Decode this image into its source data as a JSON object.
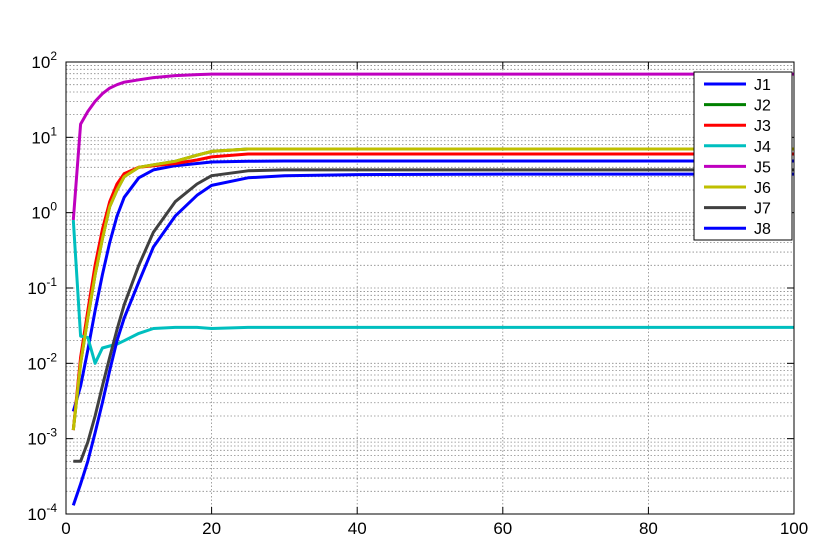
{
  "chart_data": {
    "type": "line",
    "title": "",
    "xlabel": "",
    "ylabel": "",
    "xlim": [
      0,
      100
    ],
    "ylim": [
      0.0001,
      100
    ],
    "yscale": "log",
    "grid": true,
    "legend_position": "top-right",
    "x_ticks": [
      0,
      20,
      40,
      60,
      80,
      100
    ],
    "y_ticks": [
      {
        "base": "10",
        "exp": "-4",
        "value": 0.0001
      },
      {
        "base": "10",
        "exp": "-3",
        "value": 0.001
      },
      {
        "base": "10",
        "exp": "-2",
        "value": 0.01
      },
      {
        "base": "10",
        "exp": "-1",
        "value": 0.1
      },
      {
        "base": "10",
        "exp": "0",
        "value": 1
      },
      {
        "base": "10",
        "exp": "1",
        "value": 10
      },
      {
        "base": "10",
        "exp": "2",
        "value": 100
      }
    ],
    "series": [
      {
        "name": "J1",
        "color": "#0000ff",
        "x": [
          1,
          2,
          3,
          4,
          5,
          6,
          7,
          8,
          10,
          12,
          15,
          18,
          20,
          25,
          30,
          40,
          60,
          80,
          100
        ],
        "y": [
          0.0023,
          0.005,
          0.015,
          0.05,
          0.15,
          0.4,
          0.9,
          1.6,
          2.9,
          3.7,
          4.2,
          4.5,
          4.7,
          4.8,
          4.85,
          4.85,
          4.85,
          4.85,
          4.85
        ]
      },
      {
        "name": "J2",
        "color": "#008000",
        "x": [
          1,
          2,
          3,
          4,
          5,
          6,
          7,
          8,
          10,
          12,
          15,
          18,
          20,
          25,
          30,
          40,
          60,
          80,
          100
        ],
        "y": [
          0.0013,
          0.01,
          0.04,
          0.15,
          0.45,
          1.2,
          2.0,
          3.0,
          4.0,
          4.3,
          4.8,
          5.8,
          6.5,
          7.0,
          7.0,
          7.0,
          7.0,
          7.0,
          7.0
        ]
      },
      {
        "name": "J3",
        "color": "#ff0000",
        "x": [
          1,
          2,
          3,
          4,
          5,
          6,
          7,
          8,
          10,
          12,
          15,
          18,
          20,
          25,
          30,
          40,
          60,
          80,
          100
        ],
        "y": [
          0.0013,
          0.012,
          0.05,
          0.2,
          0.6,
          1.4,
          2.4,
          3.3,
          4.0,
          4.2,
          4.5,
          5.0,
          5.5,
          6.0,
          6.0,
          6.0,
          6.0,
          6.0,
          6.0
        ]
      },
      {
        "name": "J4",
        "color": "#00bfbf",
        "x": [
          1,
          2,
          3,
          4,
          5,
          6,
          7,
          8,
          10,
          12,
          15,
          18,
          20,
          25,
          30,
          40,
          60,
          80,
          100
        ],
        "y": [
          0.8,
          0.023,
          0.022,
          0.01,
          0.016,
          0.017,
          0.018,
          0.02,
          0.025,
          0.029,
          0.03,
          0.03,
          0.029,
          0.03,
          0.03,
          0.03,
          0.03,
          0.03,
          0.03
        ]
      },
      {
        "name": "J5",
        "color": "#bf00bf",
        "x": [
          1,
          2,
          3,
          4,
          5,
          6,
          7,
          8,
          10,
          12,
          15,
          18,
          20,
          25,
          30,
          40,
          60,
          80,
          100
        ],
        "y": [
          0.8,
          15,
          22,
          30,
          38,
          45,
          50,
          54,
          58,
          62,
          66,
          68,
          69,
          69,
          69,
          69,
          69,
          69,
          69
        ]
      },
      {
        "name": "J6",
        "color": "#bfbf00",
        "x": [
          1,
          2,
          3,
          4,
          5,
          6,
          7,
          8,
          10,
          12,
          15,
          18,
          20,
          25,
          30,
          40,
          60,
          80,
          100
        ],
        "y": [
          0.0013,
          0.01,
          0.04,
          0.15,
          0.45,
          1.2,
          2.0,
          3.0,
          4.0,
          4.3,
          4.8,
          5.8,
          6.5,
          7.0,
          7.0,
          7.0,
          7.0,
          7.0,
          7.0
        ]
      },
      {
        "name": "J7",
        "color": "#404040",
        "x": [
          1,
          2,
          3,
          4,
          5,
          6,
          7,
          8,
          10,
          12,
          15,
          18,
          20,
          25,
          30,
          40,
          60,
          80,
          100
        ],
        "y": [
          0.0005,
          0.0005,
          0.0009,
          0.002,
          0.005,
          0.012,
          0.028,
          0.06,
          0.2,
          0.55,
          1.4,
          2.4,
          3.1,
          3.6,
          3.7,
          3.7,
          3.7,
          3.7,
          3.7
        ]
      },
      {
        "name": "J8",
        "color": "#0000ff",
        "x": [
          1,
          2,
          3,
          4,
          5,
          6,
          7,
          8,
          10,
          12,
          15,
          18,
          20,
          25,
          30,
          40,
          60,
          80,
          100
        ],
        "y": [
          0.00013,
          0.00025,
          0.0005,
          0.0012,
          0.003,
          0.008,
          0.02,
          0.04,
          0.12,
          0.35,
          0.9,
          1.7,
          2.3,
          2.9,
          3.1,
          3.2,
          3.25,
          3.25,
          3.25
        ]
      }
    ]
  }
}
